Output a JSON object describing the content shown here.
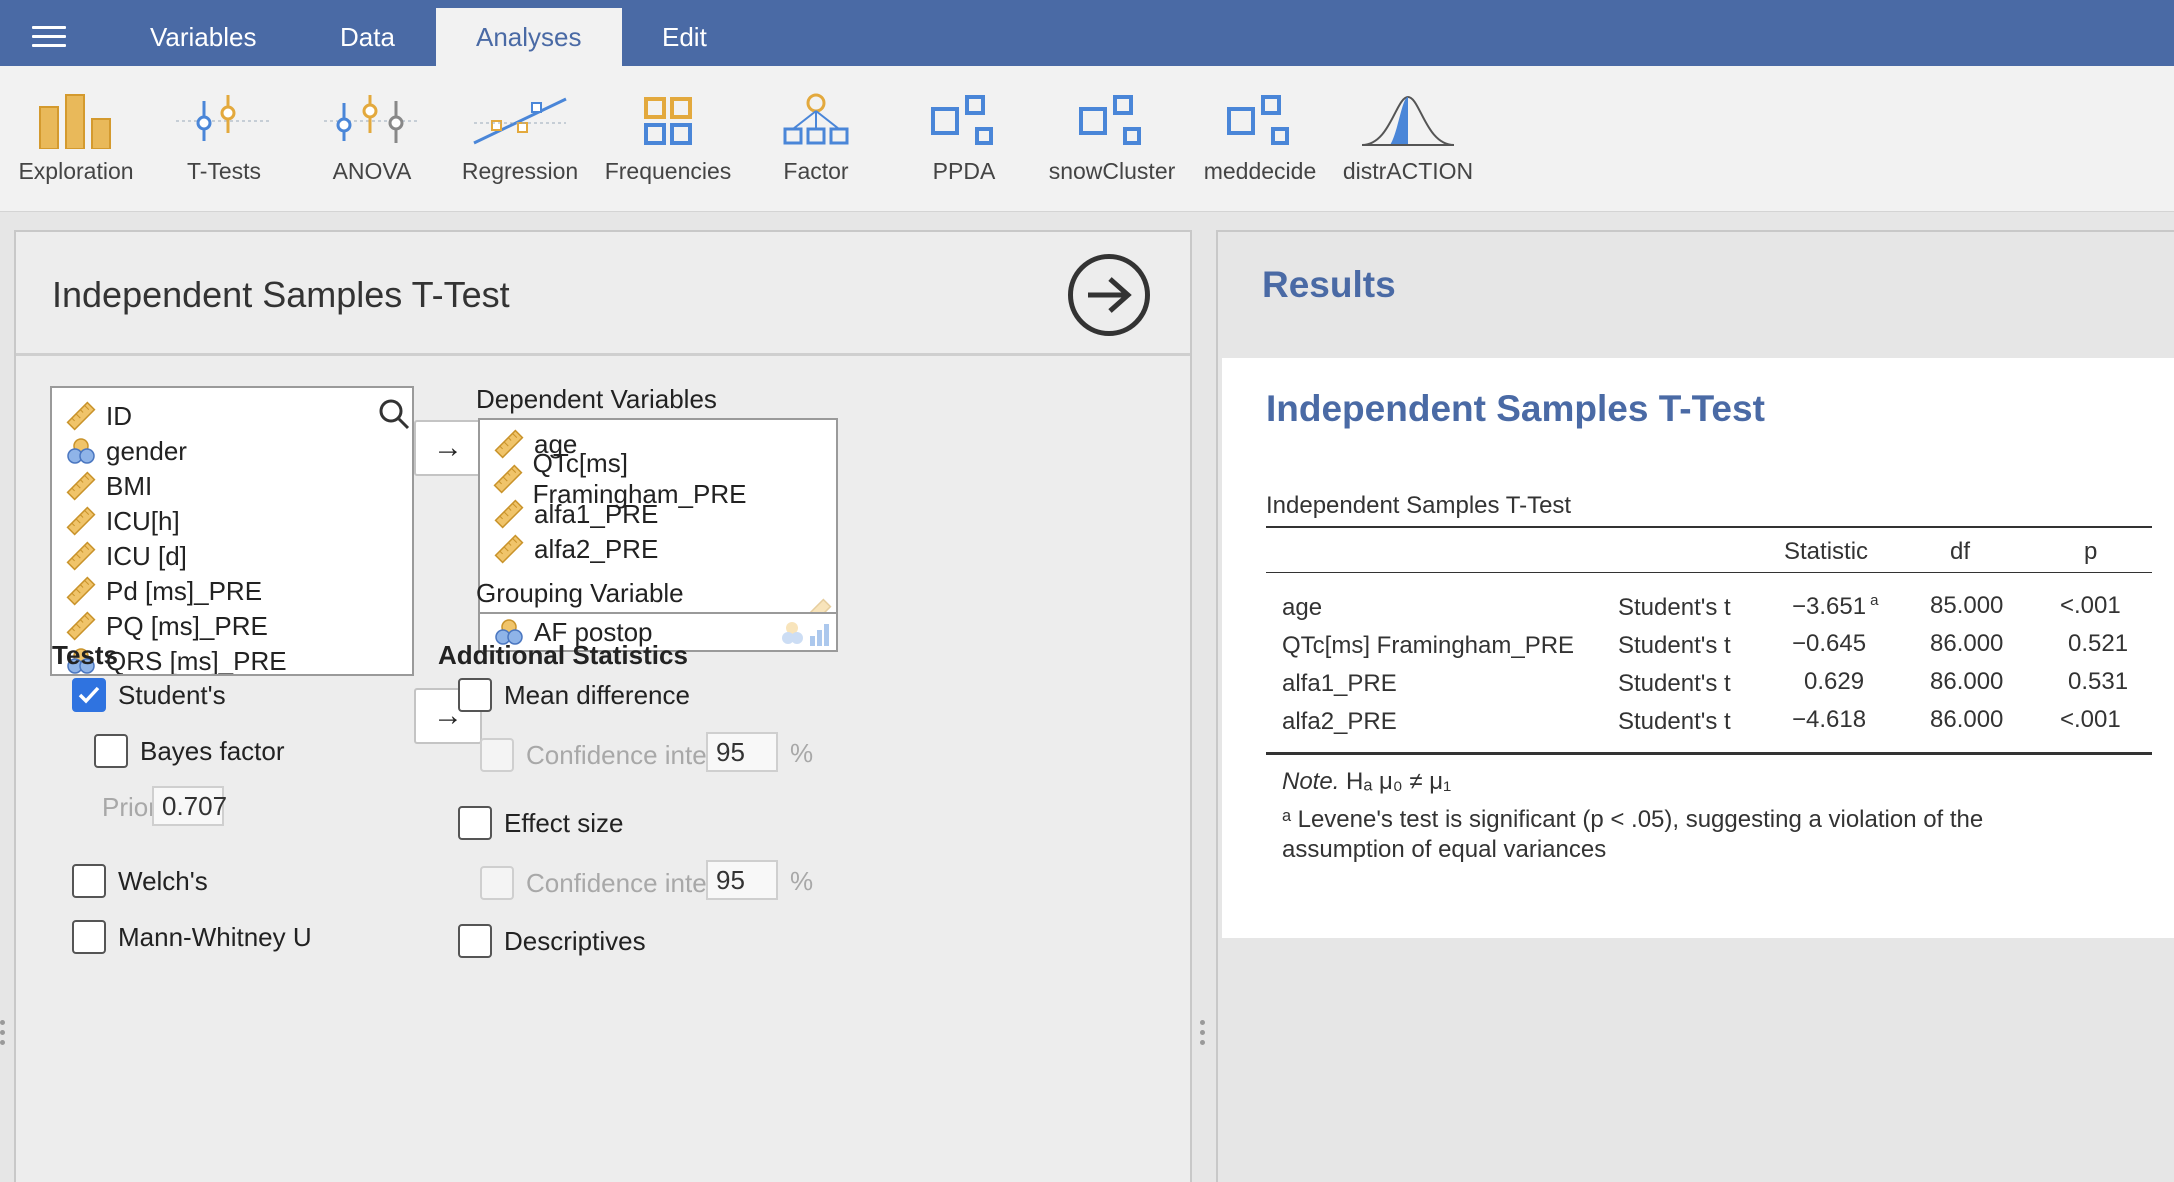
{
  "menubar": {
    "tabs": [
      {
        "label": "Variables"
      },
      {
        "label": "Data"
      },
      {
        "label": "Analyses"
      },
      {
        "label": "Edit"
      }
    ]
  },
  "ribbon": {
    "items": [
      {
        "label": "Exploration",
        "icon": "exploration-icon"
      },
      {
        "label": "T-Tests",
        "icon": "ttests-icon"
      },
      {
        "label": "ANOVA",
        "icon": "anova-icon"
      },
      {
        "label": "Regression",
        "icon": "regression-icon"
      },
      {
        "label": "Frequencies",
        "icon": "frequencies-icon"
      },
      {
        "label": "Factor",
        "icon": "factor-icon"
      },
      {
        "label": "PPDA",
        "icon": "module-icon"
      },
      {
        "label": "snowCluster",
        "icon": "module-icon"
      },
      {
        "label": "meddecide",
        "icon": "module-icon"
      },
      {
        "label": "distrACTION",
        "icon": "distribution-icon"
      }
    ]
  },
  "options": {
    "title": "Independent Samples T-Test",
    "available_vars": [
      {
        "name": "ID",
        "type": "continuous"
      },
      {
        "name": "gender",
        "type": "nominal"
      },
      {
        "name": "BMI",
        "type": "continuous"
      },
      {
        "name": "ICU[h]",
        "type": "continuous"
      },
      {
        "name": "ICU [d]",
        "type": "continuous"
      },
      {
        "name": "Pd [ms]_PRE",
        "type": "continuous"
      },
      {
        "name": "PQ [ms]_PRE",
        "type": "continuous"
      },
      {
        "name": "QRS [ms]_PRE",
        "type": "nominal"
      }
    ],
    "dependent_label": "Dependent Variables",
    "dependent_vars": [
      {
        "name": "age"
      },
      {
        "name": "QTc[ms] Framingham_PRE"
      },
      {
        "name": "alfa1_PRE"
      },
      {
        "name": "alfa2_PRE"
      }
    ],
    "grouping_label": "Grouping Variable",
    "grouping_var": "AF postop",
    "tests_head": "Tests",
    "students_label": "Student's",
    "bayes_label": "Bayes factor",
    "prior_label": "Prior",
    "prior_value": "0.707",
    "welch_label": "Welch's",
    "mann_label": "Mann-Whitney U",
    "additional_head": "Additional Statistics",
    "mean_diff_label": "Mean difference",
    "ci_label": "Confidence interval",
    "ci_value": "95",
    "pct": "%",
    "effect_label": "Effect size",
    "descriptives_label": "Descriptives"
  },
  "results": {
    "title": "Results",
    "analysis_title": "Independent Samples T-Test",
    "table_title": "Independent Samples T-Test",
    "columns": [
      "Statistic",
      "df",
      "p"
    ],
    "rows": [
      {
        "var": "age",
        "test": "Student's t",
        "stat": "−3.651",
        "sup": "a",
        "df": "85.000",
        "p": "<.001"
      },
      {
        "var": "QTc[ms] Framingham_PRE",
        "test": "Student's t",
        "stat": "−0.645",
        "sup": "",
        "df": "86.000",
        "p": "0.521"
      },
      {
        "var": "alfa1_PRE",
        "test": "Student's t",
        "stat": "0.629",
        "sup": "",
        "df": "86.000",
        "p": "0.531"
      },
      {
        "var": "alfa2_PRE",
        "test": "Student's t",
        "stat": "−4.618",
        "sup": "",
        "df": "86.000",
        "p": "<.001"
      }
    ],
    "note_prefix": "Note.",
    "note_hyp": "Hₐ μ₀ ≠ μ₁",
    "footnote_line1": "ᵃ Levene's test is significant (p < .05), suggesting a violation of the",
    "footnote_line2": "assumption of equal variances"
  },
  "colors": {
    "brand": "#4a6aa5",
    "accent": "#2f73e0",
    "ruler": "#e3a93d"
  }
}
